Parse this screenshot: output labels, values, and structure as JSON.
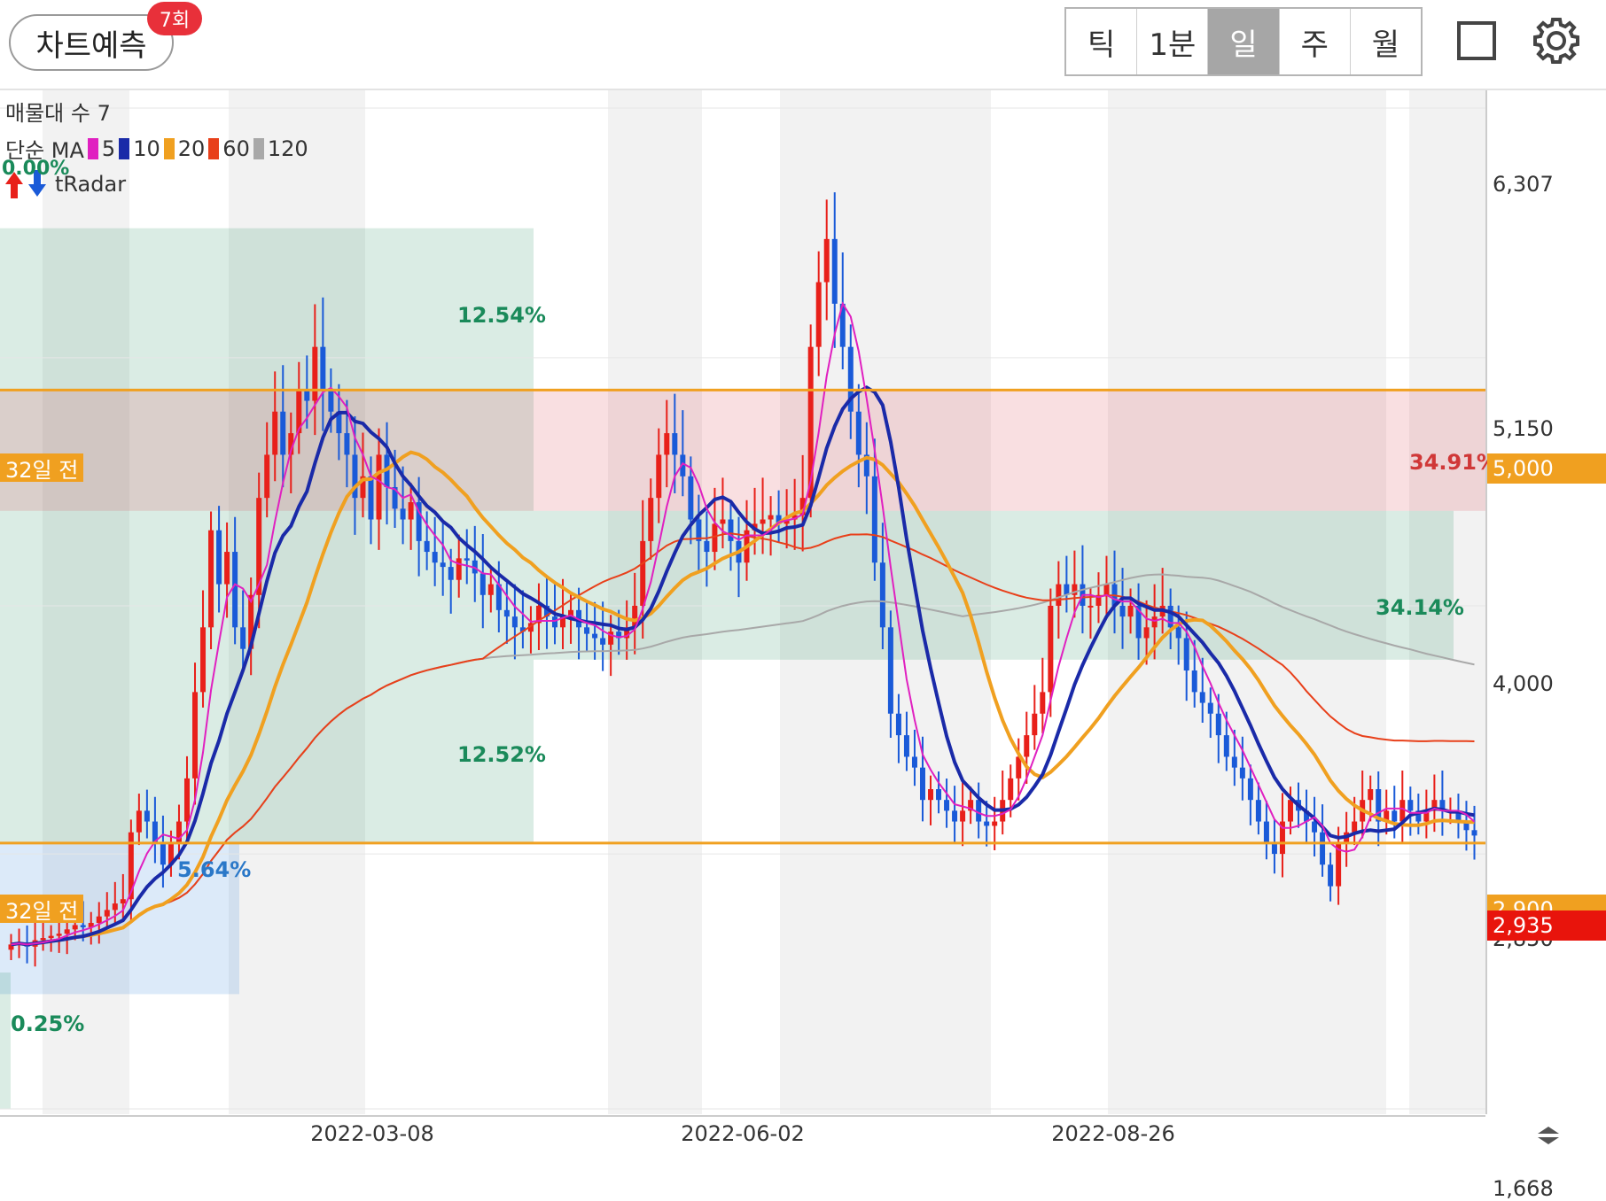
{
  "header": {
    "predict_button": "차트예측",
    "predict_count": "7회",
    "period_tabs": [
      {
        "label": "틱",
        "active": false
      },
      {
        "label": "1분",
        "active": false
      },
      {
        "label": "일",
        "active": true
      },
      {
        "label": "주",
        "active": false
      },
      {
        "label": "월",
        "active": false
      }
    ],
    "icons": [
      "square-icon",
      "gear-icon"
    ]
  },
  "overlay": {
    "volume_profile_label": "매물대 수 7",
    "ma_label": "단순 MA",
    "ma_items": [
      {
        "period": "5",
        "color": "#e020c0"
      },
      {
        "period": "10",
        "color": "#1a2aa8"
      },
      {
        "period": "20",
        "color": "#f0a020"
      },
      {
        "period": "60",
        "color": "#e8401a"
      },
      {
        "period": "120",
        "color": "#a8a8a8"
      }
    ],
    "radar_label": "tRadar",
    "radar_pct": "0.00%"
  },
  "chart_data": {
    "type": "candlestick",
    "interval": "daily",
    "ylim": [
      1668,
      6307
    ],
    "y_ticks": [
      "6,307",
      "5,150",
      "4,000",
      "2,850",
      "1,668"
    ],
    "x_ticks": [
      "2022-03-08",
      "2022-06-02",
      "2022-08-26"
    ],
    "reference_lines": [
      {
        "label": "32일 전",
        "price": 5000,
        "tag": "5,000",
        "color": "#f0a020"
      },
      {
        "label": "32일 전",
        "price": 2900,
        "tag": "2,900",
        "color": "#f0a020"
      }
    ],
    "current_price": {
      "value": 2935,
      "tag": "2,935",
      "color": "#e8140c"
    },
    "zones": [
      {
        "label": "12.54%",
        "color": "#1a8a5a",
        "from": 4440,
        "to": 5750
      },
      {
        "label": "34.91%",
        "color": "#d03838",
        "from": 4440,
        "to": 5000
      },
      {
        "label": "34.14%",
        "color": "#1a8a5a",
        "from": 3750,
        "to": 4440
      },
      {
        "label": "12.52%",
        "color": "#1a8a5a",
        "from": 2900,
        "to": 3750
      },
      {
        "label": "5.64%",
        "color": "#2a78c8",
        "from": 2200,
        "to": 2900
      },
      {
        "label": "0.25%",
        "color": "#1a8a5a",
        "from": 1668,
        "to": 2300
      }
    ],
    "series_close": [
      2430,
      2440,
      2420,
      2450,
      2460,
      2470,
      2480,
      2500,
      2520,
      2510,
      2530,
      2560,
      2590,
      2620,
      2640,
      2950,
      3050,
      3000,
      2900,
      2800,
      2900,
      3000,
      3200,
      3600,
      3900,
      4350,
      4100,
      4250,
      3900,
      3800,
      4050,
      4500,
      4700,
      4900,
      4700,
      4800,
      5000,
      4950,
      5200,
      5000,
      4900,
      4800,
      4700,
      4500,
      4600,
      4400,
      4700,
      4550,
      4450,
      4400,
      4480,
      4300,
      4250,
      4200,
      4180,
      4120,
      4220,
      4210,
      4150,
      4050,
      4100,
      3980,
      3950,
      3900,
      3880,
      3920,
      4000,
      3950,
      3900,
      3950,
      3980,
      3900,
      3870,
      3850,
      3820,
      3880,
      3850,
      3900,
      4000,
      4300,
      4500,
      4700,
      4800,
      4700,
      4600,
      4400,
      4300,
      4250,
      4380,
      4400,
      4300,
      4200,
      4350,
      4380,
      4400,
      4420,
      4380,
      4400,
      4420,
      4500,
      5200,
      5500,
      5700,
      5400,
      5200,
      4900,
      4700,
      4600,
      4200,
      3900,
      3500,
      3400,
      3300,
      3250,
      3100,
      3150,
      3100,
      3050,
      3000,
      3050,
      3100,
      3000,
      2980,
      3000,
      3100,
      3200,
      3300,
      3400,
      3500,
      3600,
      4000,
      4100,
      4050,
      4100,
      4000,
      4000,
      4050,
      4100,
      4000,
      3950,
      4000,
      3850,
      3900,
      3950,
      4000,
      3900,
      3850,
      3700,
      3600,
      3550,
      3500,
      3400,
      3300,
      3250,
      3200,
      3100,
      3000,
      2900,
      2850,
      3000,
      3100,
      3050,
      3000,
      2950,
      2800,
      2700,
      2900,
      2950,
      3000,
      3100,
      3150,
      3000,
      3050,
      3000,
      3100,
      3050,
      3000,
      3050,
      3100,
      3050,
      3050,
      3000,
      2960,
      2935
    ]
  },
  "zone_labels": {
    "z1": "12.54%",
    "z2": "34.91%",
    "z3": "34.14%",
    "z4": "12.52%",
    "z5": "5.64%",
    "z6": "0.25%"
  },
  "ref_labels": {
    "top": "32일 전",
    "bottom": "32일 전"
  },
  "price_tags": {
    "top": "5,000",
    "bottom": "2,900",
    "current": "2,935"
  },
  "y_axis": {
    "t1": "6,307",
    "t2": "5,150",
    "t3": "4,000",
    "t4": "2,850",
    "t5": "1,668"
  },
  "x_axis": {
    "t1": "2022-03-08",
    "t2": "2022-06-02",
    "t3": "2022-08-26"
  }
}
